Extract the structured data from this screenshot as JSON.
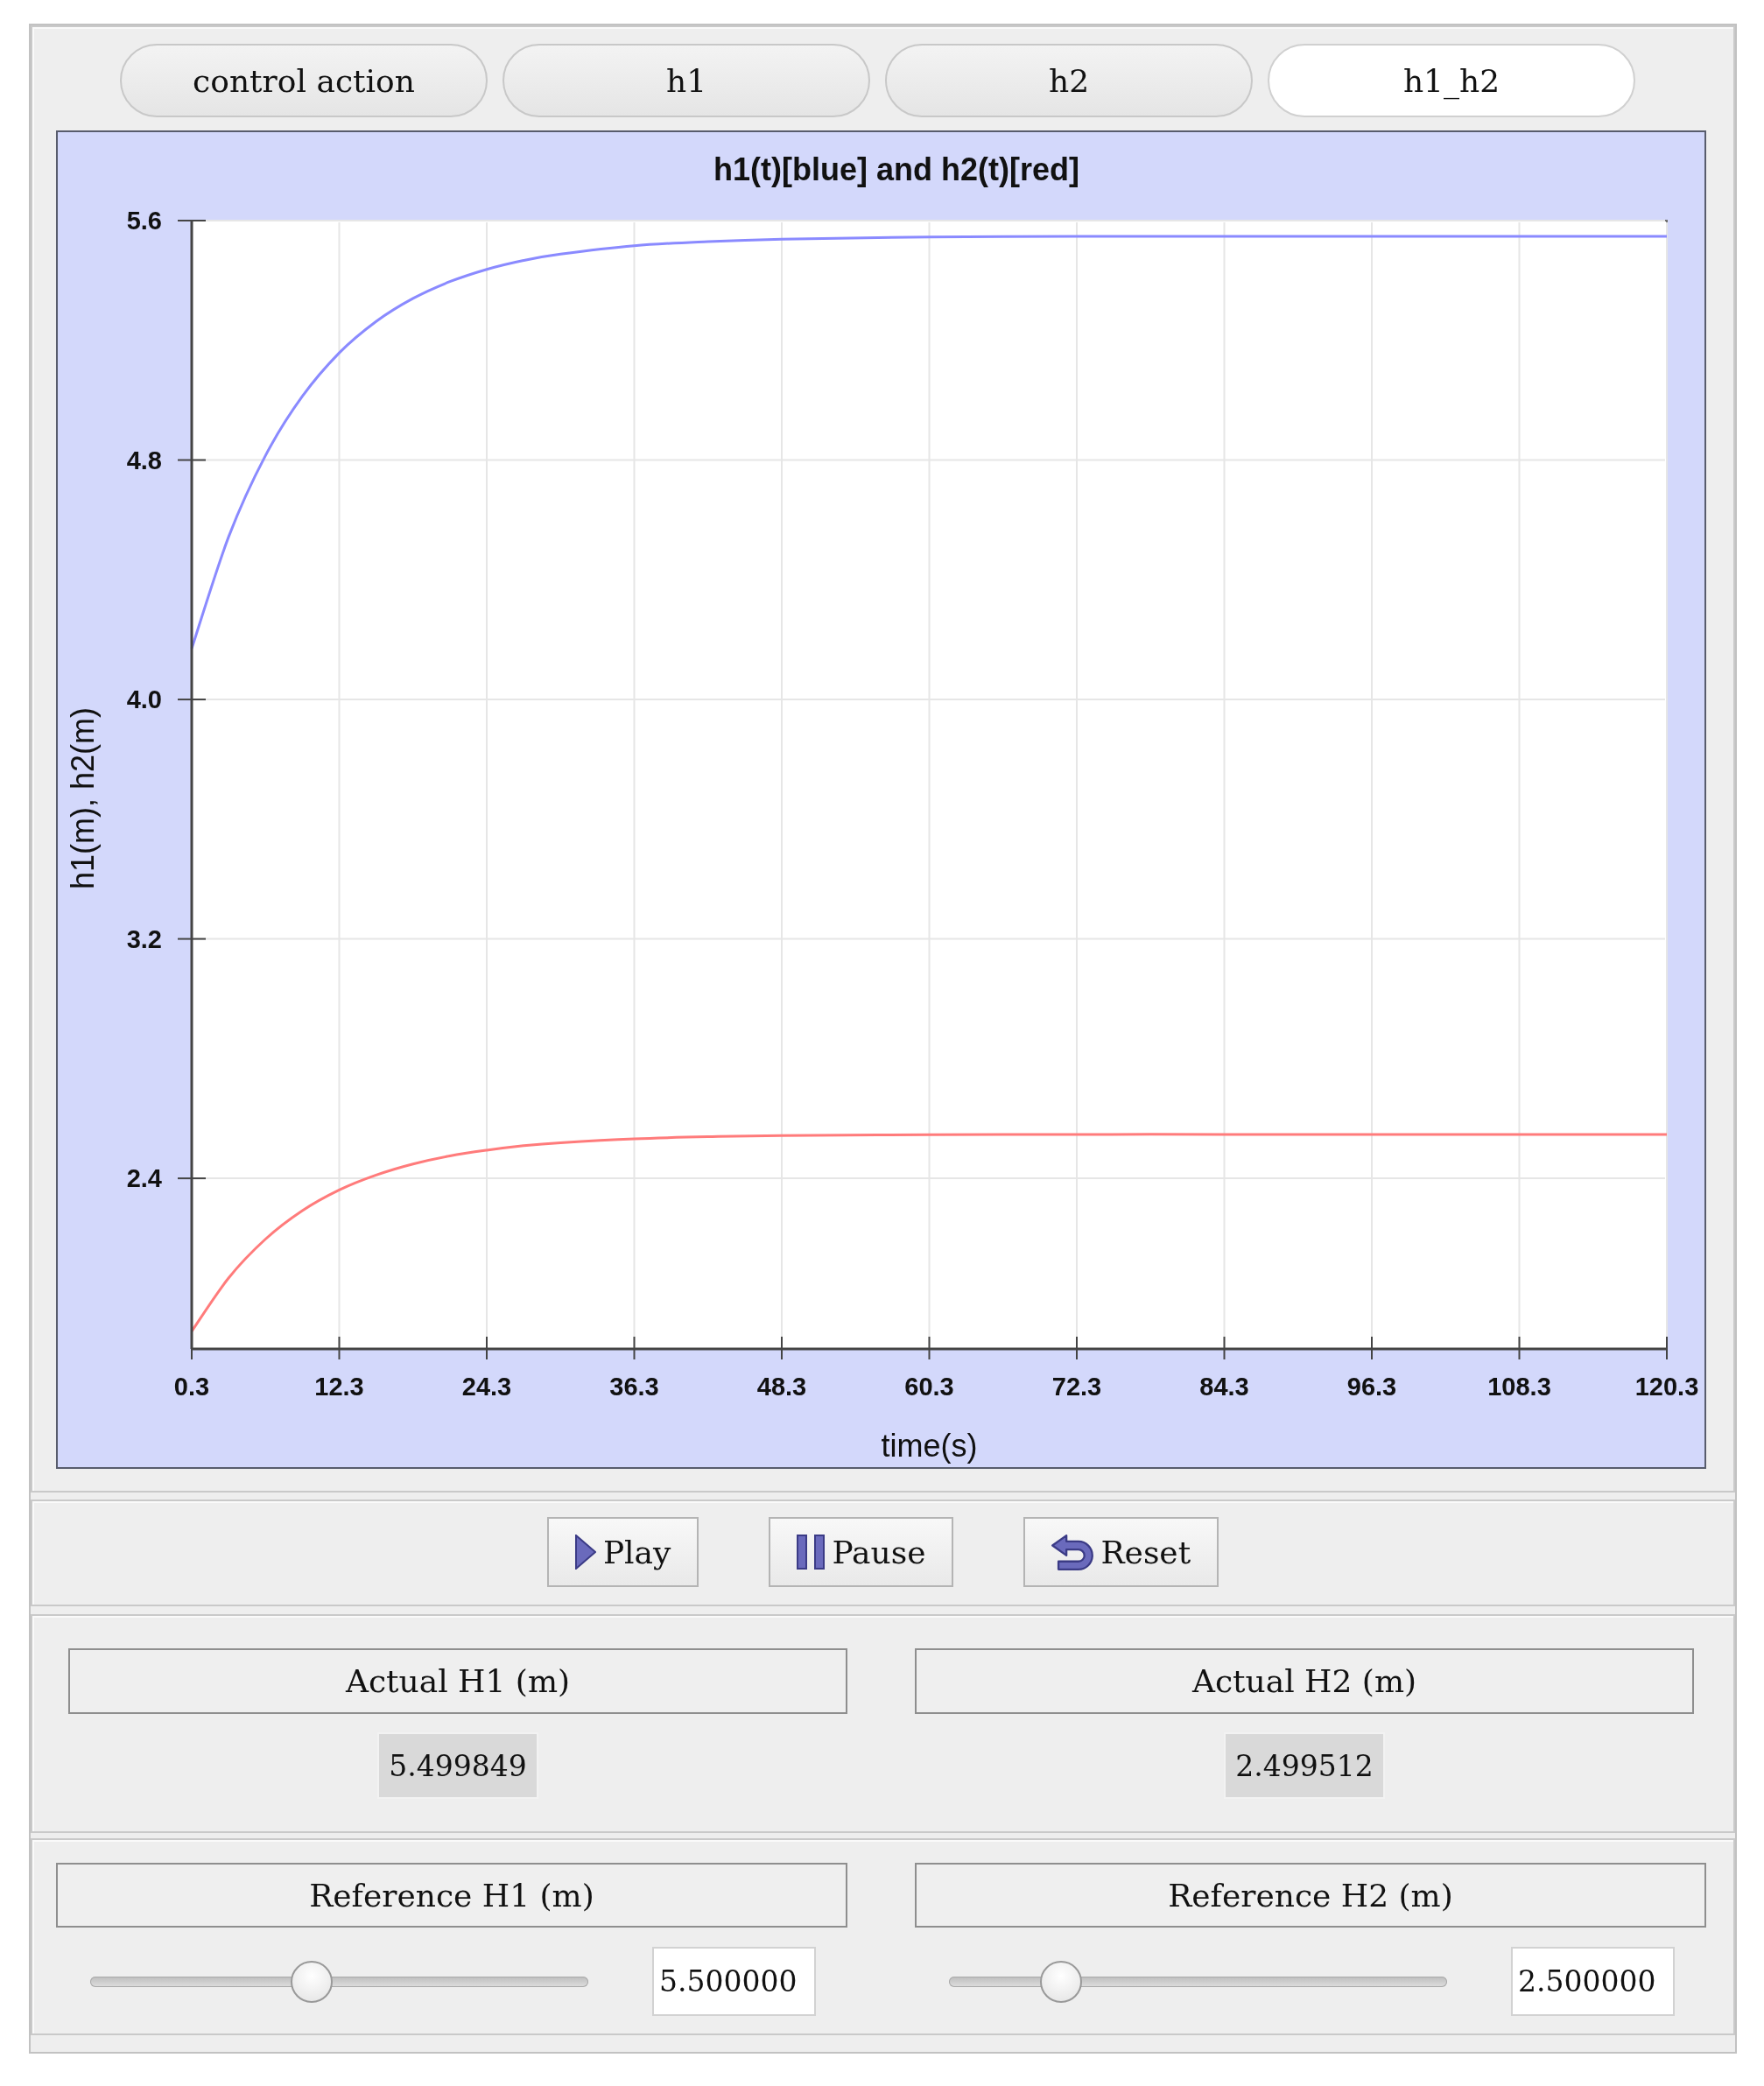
{
  "tabs": [
    {
      "label": "control action",
      "selected": false
    },
    {
      "label": "h1",
      "selected": false
    },
    {
      "label": "h2",
      "selected": false
    },
    {
      "label": "h1_h2",
      "selected": true
    }
  ],
  "chart": {
    "chart_data": {
      "type": "line",
      "title": "h1(t)[blue] and h2(t)[red]",
      "xlabel": "time(s)",
      "ylabel": "h1(m), h2(m)",
      "x": [
        0.3,
        3.3,
        6.3,
        9.3,
        12.3,
        15.3,
        18.3,
        21.3,
        24.3,
        27.3,
        30.3,
        36.3,
        42.3,
        48.3,
        60.3,
        72.3,
        84.3,
        96.3,
        108.3,
        120.3
      ],
      "series": [
        {
          "color": "#8a8aff",
          "values": [
            4.17,
            4.543,
            4.815,
            5.013,
            5.158,
            5.263,
            5.34,
            5.396,
            5.437,
            5.467,
            5.488,
            5.516,
            5.53,
            5.538,
            5.545,
            5.547,
            5.547,
            5.547,
            5.547,
            5.547
          ]
        },
        {
          "color": "#ff7b7b",
          "values": [
            1.889,
            2.067,
            2.197,
            2.292,
            2.361,
            2.411,
            2.448,
            2.475,
            2.494,
            2.509,
            2.519,
            2.532,
            2.539,
            2.543,
            2.546,
            2.547,
            2.547,
            2.547,
            2.547,
            2.547
          ]
        }
      ],
      "xlim": [
        0.3,
        120.3
      ],
      "ylim": [
        1.83,
        5.6
      ],
      "xticks": [
        0.3,
        12.3,
        24.3,
        36.3,
        48.3,
        60.3,
        72.3,
        84.3,
        96.3,
        108.3,
        120.3
      ],
      "yticks": [
        2.4,
        3.2,
        {
          "value": 4,
          "label": "4.0"
        },
        4.8,
        5.6
      ],
      "grid": true
    }
  },
  "controls": [
    {
      "kind": "play",
      "label": "Play"
    },
    {
      "kind": "pause",
      "label": "Pause"
    },
    {
      "kind": "reset",
      "label": "Reset"
    }
  ],
  "actual": [
    {
      "label": "Actual H1 (m)",
      "value": "5.499849"
    },
    {
      "label": "Actual H2 (m)",
      "value": "2.499512"
    }
  ],
  "reference": [
    {
      "label": "Reference H1 (m)",
      "level": 0.44,
      "value": "5.500000"
    },
    {
      "label": "Reference H2 (m)",
      "level": 0.2,
      "value": "2.500000"
    }
  ]
}
